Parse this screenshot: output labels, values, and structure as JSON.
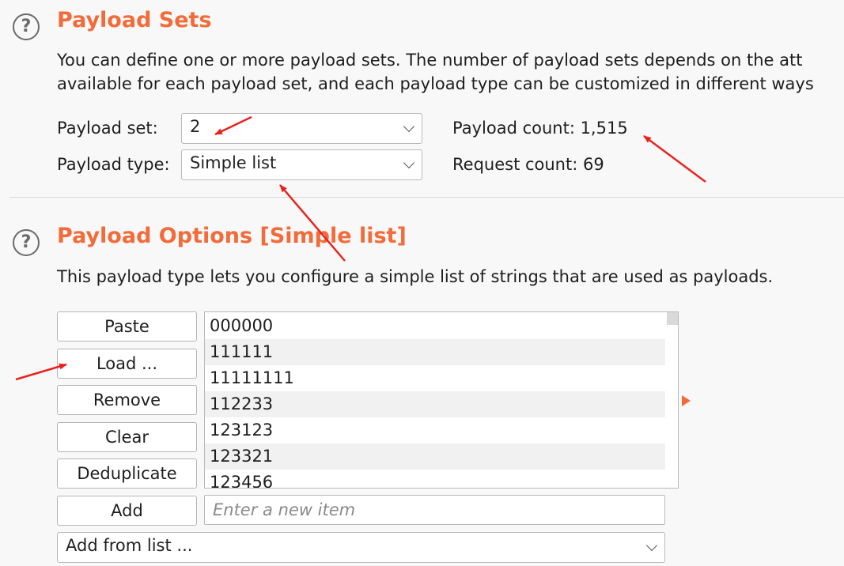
{
  "payload_sets": {
    "title": "Payload Sets",
    "description_line1": "You can define one or more payload sets. The number of payload sets depends on the att",
    "description_line2": "available for each payload set, and each payload type can be customized in different ways",
    "payload_set_label": "Payload set:",
    "payload_set_value": "2",
    "payload_type_label": "Payload type:",
    "payload_type_value": "Simple list",
    "payload_count": "Payload count: 1,515",
    "request_count": "Request count: 69"
  },
  "payload_options": {
    "title": "Payload Options [Simple list]",
    "description": "This payload type lets you configure a simple list of strings that are used as payloads.",
    "buttons": {
      "paste": "Paste",
      "load": "Load ...",
      "remove": "Remove",
      "clear": "Clear",
      "deduplicate": "Deduplicate",
      "add": "Add"
    },
    "list_items": [
      "000000",
      "111111",
      "11111111",
      "112233",
      "123123",
      "123321",
      "123456"
    ],
    "new_item_placeholder": "Enter a new item",
    "add_from_list": "Add from list ..."
  },
  "icons": {
    "help": "help-circle-icon",
    "dropdown": "chevron-down-icon",
    "expand": "triangle-right-icon"
  },
  "colors": {
    "accent": "#f26b3a",
    "annotation": "#e8231f"
  }
}
